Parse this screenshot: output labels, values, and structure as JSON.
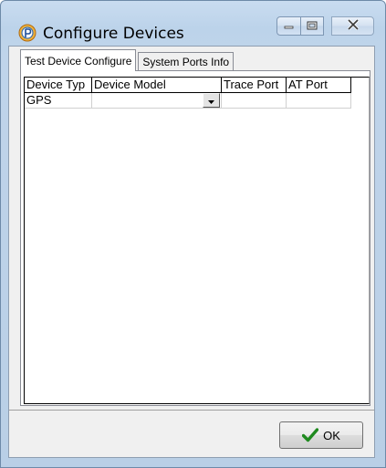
{
  "window": {
    "title": "Configure Devices",
    "app_icon": "p-logo-icon"
  },
  "caption_buttons": {
    "minimize": "minimize-icon",
    "maximize": "maximize-icon",
    "close": "close-icon"
  },
  "tabs": [
    {
      "label": "Test Device Configure",
      "active": true
    },
    {
      "label": "System Ports Info",
      "active": false
    }
  ],
  "grid": {
    "columns": [
      "Device Typ",
      "Device Model",
      "Trace Port",
      "AT Port"
    ],
    "rows": [
      {
        "device_type": "GPS",
        "device_model": "",
        "trace_port": "",
        "at_port": ""
      }
    ]
  },
  "footer": {
    "ok_label": "OK",
    "ok_icon": "checkmark-icon"
  },
  "colors": {
    "title_bar": "#c9dcf0",
    "client_bg": "#f0f0f0",
    "check_green": "#2a9a2a"
  }
}
